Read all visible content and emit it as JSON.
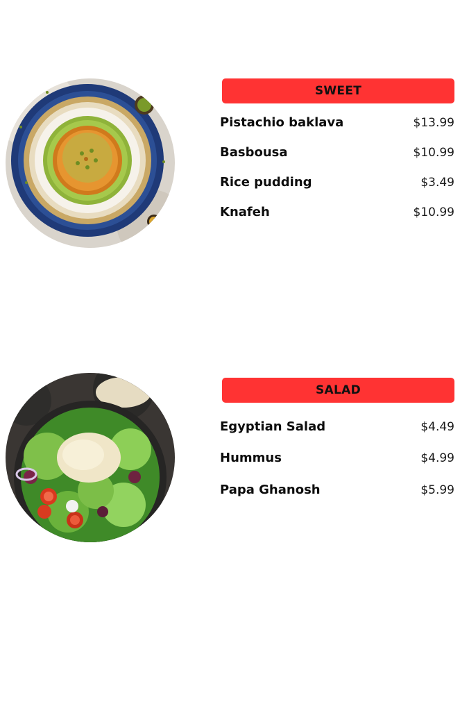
{
  "colors": {
    "accent": "#ff3333",
    "text": "#111111",
    "background": "#ffffff"
  },
  "sections": [
    {
      "category": "SWEET",
      "image_subject": "kunafa-dessert-photo",
      "items": [
        {
          "name": "Pistachio baklava",
          "price": "$13.99"
        },
        {
          "name": "Basbousa",
          "price": "$10.99"
        },
        {
          "name": "Rice pudding",
          "price": "$3.49"
        },
        {
          "name": "Knafeh",
          "price": "$10.99"
        }
      ]
    },
    {
      "category": "SALAD",
      "image_subject": "salad-bowl-photo",
      "items": [
        {
          "name": "Egyptian Salad",
          "price": "$4.49"
        },
        {
          "name": "Hummus",
          "price": "$4.99"
        },
        {
          "name": "Papa Ghanosh",
          "price": "$5.99"
        }
      ]
    }
  ]
}
